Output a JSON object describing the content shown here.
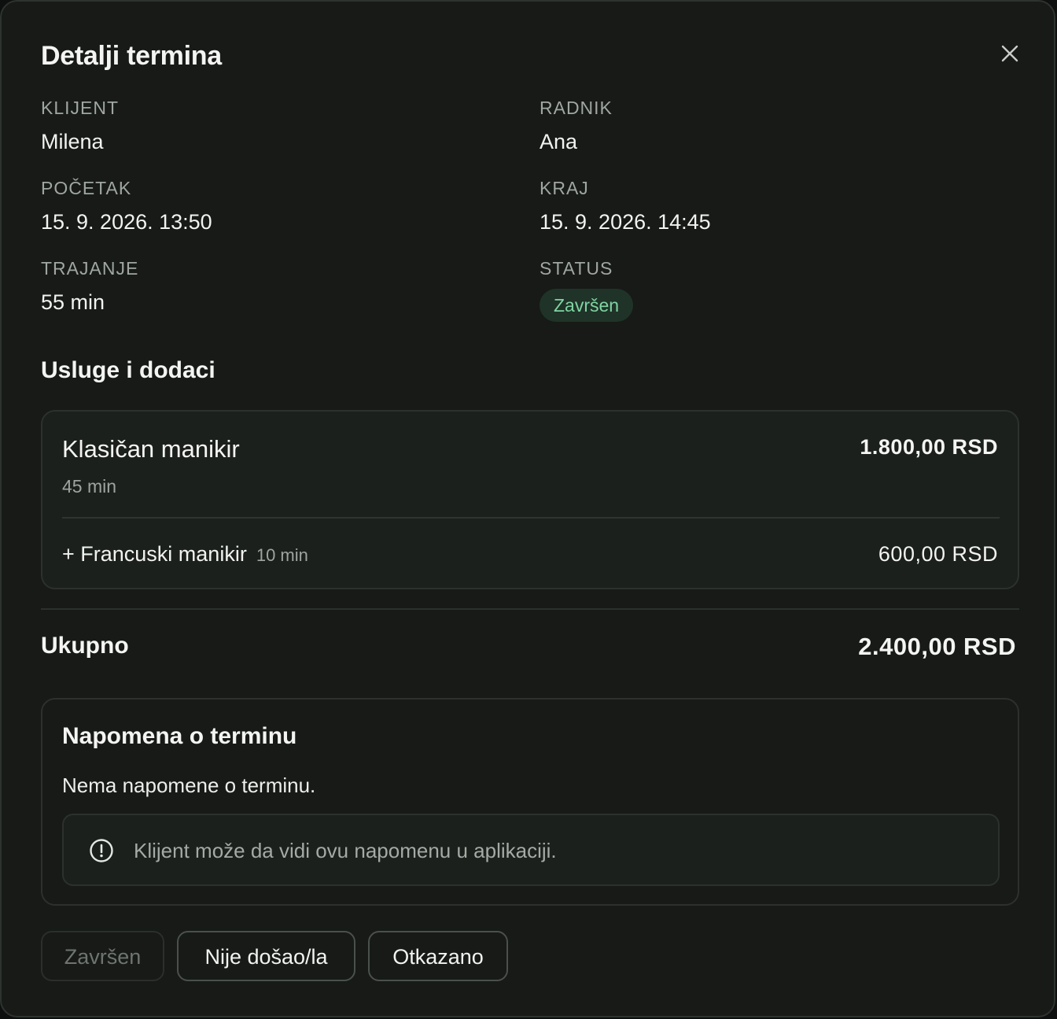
{
  "modal": {
    "title": "Detalji termina"
  },
  "fields": {
    "client_label": "KLIJENT",
    "client_value": "Milena",
    "worker_label": "RADNIK",
    "worker_value": "Ana",
    "start_label": "POČETAK",
    "start_value": "15. 9. 2026. 13:50",
    "end_label": "KRAJ",
    "end_value": "15. 9. 2026. 14:45",
    "duration_label": "TRAJANJE",
    "duration_value": "55 min",
    "status_label": "STATUS",
    "status_value": "Završen",
    "status_color": "#7fd4a2"
  },
  "services": {
    "title": "Usluge i dodaci",
    "main": {
      "name": "Klasičan manikir",
      "duration": "45 min",
      "price": "1.800,00 RSD"
    },
    "addon": {
      "name": "+ Francuski manikir",
      "duration": "10 min",
      "price": "600,00 RSD"
    }
  },
  "total": {
    "label": "Ukupno",
    "value": "2.400,00 RSD"
  },
  "note": {
    "title": "Napomena o terminu",
    "text": "Nema napomene o terminu.",
    "info_icon": "info-circle-icon",
    "info_text": "Klijent može da vidi ovu napomenu u aplikaciji."
  },
  "actions": {
    "done_label": "Završen",
    "no_show_label": "Nije došao/la",
    "cancelled_label": "Otkazano"
  },
  "icons": {
    "close": "close-icon"
  },
  "colors": {
    "background": "#171a17",
    "accent_green": "#7fd4a2",
    "badge_background": "#203328"
  }
}
